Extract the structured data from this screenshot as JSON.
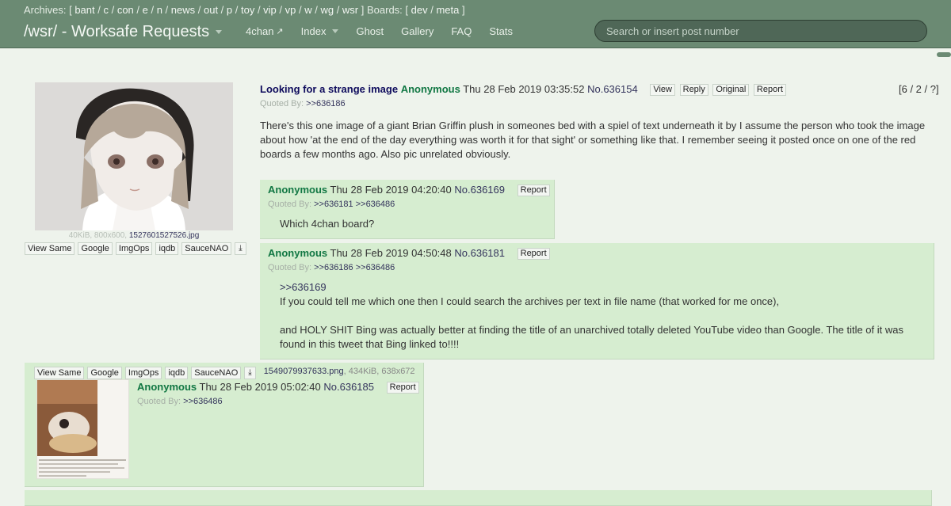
{
  "header": {
    "archives_label": "Archives:",
    "archives": [
      "bant",
      "c",
      "con",
      "e",
      "n",
      "news",
      "out",
      "p",
      "toy",
      "vip",
      "vp",
      "w",
      "wg",
      "wsr"
    ],
    "boards_label": "Boards:",
    "boards": [
      "dev",
      "meta"
    ],
    "board_title": "/wsr/ - Worksafe Requests",
    "nav": [
      "4chan",
      "Index",
      "Ghost",
      "Gallery",
      "FAQ",
      "Stats"
    ],
    "search_placeholder": "Search or insert post number"
  },
  "op": {
    "file_size": "40KiB, 800x600,",
    "file_name": "1527601527526.jpg",
    "search_buttons": [
      "View Same",
      "Google",
      "ImgOps",
      "iqdb",
      "SauceNAO"
    ],
    "subject": "Looking for a strange image",
    "name": "Anonymous",
    "date": "Thu 28 Feb 2019 03:35:52",
    "no_label": "No.",
    "number": "636154",
    "buttons": [
      "View",
      "Reply",
      "Original",
      "Report"
    ],
    "stats": "[6 / 2 / ?]",
    "quoted_label": "Quoted By:",
    "quoted_by": ">>636186",
    "body": "There's this one image of a giant Brian Griffin plush in someones bed with a spiel of text underneath it by I assume the person who took the image about how 'at the end of the day everything was worth it for that sight' or something like that. I remember seeing it posted once on one of the red boards a few months ago. Also pic unrelated obviously."
  },
  "replies": [
    {
      "name": "Anonymous",
      "date": "Thu 28 Feb 2019 04:20:40",
      "no_label": "No.",
      "number": "636169",
      "report": "Report",
      "quoted_label": "Quoted By:",
      "quoted_by": ">>636181 >>636486",
      "body": "Which 4chan board?"
    },
    {
      "name": "Anonymous",
      "date": "Thu 28 Feb 2019 04:50:48",
      "no_label": "No.",
      "number": "636181",
      "report": "Report",
      "quoted_label": "Quoted By:",
      "quoted_by": ">>636186 >>636486",
      "quote_link": ">>636169",
      "body_line1": "If you could tell me which one then I could search the archives per text in file name (that worked for me once),",
      "body_line2": "and HOLY SHIT Bing was actually better at finding the title of an unarchived totally deleted YouTube video than Google. The title of it was found in this tweet that Bing linked to!!!!"
    },
    {
      "search_buttons": [
        "View Same",
        "Google",
        "ImgOps",
        "iqdb",
        "SauceNAO"
      ],
      "file_name": "1549079937633.png",
      "file_size": ", 434KiB, 638x672",
      "name": "Anonymous",
      "date": "Thu 28 Feb 2019 05:02:40",
      "no_label": "No.",
      "number": "636185",
      "report": "Report",
      "quoted_label": "Quoted By:",
      "quoted_by": ">>636486"
    }
  ]
}
